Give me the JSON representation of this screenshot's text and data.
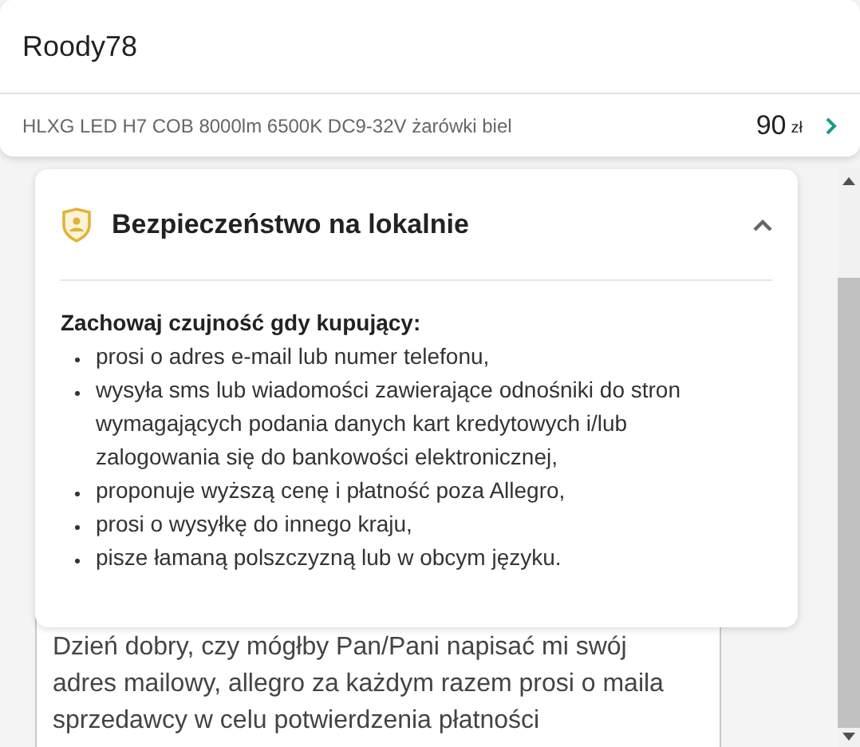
{
  "header": {
    "username": "Roody78",
    "product": {
      "title": "HLXG LED H7 COB 8000lm 6500K DC9-32V żarówki biel",
      "price": "90",
      "currency": "zł"
    }
  },
  "safety_panel": {
    "title": "Bezpieczeństwo na lokalnie",
    "expanded": true,
    "heading": "Zachowaj czujność gdy kupujący:",
    "items": [
      "prosi o adres e-mail lub numer telefonu,",
      "wysyła sms lub wiadomości zawierające odnośniki do stron wymagających podania danych kart kredytowych i/lub zalogowania się do bankowości elektronicznej,",
      "proponuje wyższą cenę i płatność poza Allegro,",
      "prosi o wysyłkę do innego kraju,",
      "pisze łamaną polszczyzną lub w obcym języku."
    ]
  },
  "message": {
    "text": "Dzień dobry, czy mógłby Pan/Pani napisać mi swój adres mailowy, allegro za każdym razem prosi o maila sprzedawcy w celu potwierdzenia płatności"
  }
}
